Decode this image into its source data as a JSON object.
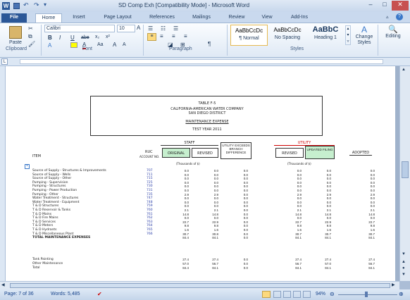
{
  "window": {
    "title": "SD Comp Exh [Compatibility Mode] - Microsoft Word",
    "qat_icons": [
      "word-icon",
      "save-icon",
      "undo-icon",
      "redo-icon",
      "customize-icon"
    ]
  },
  "tabs": [
    "File",
    "Home",
    "Insert",
    "Page Layout",
    "References",
    "Mailings",
    "Review",
    "View",
    "Add-Ins"
  ],
  "ribbon": {
    "clipboard": {
      "paste": "Paste",
      "group": "Clipboard"
    },
    "font": {
      "name": "Calibri",
      "size": "10",
      "group": "Font",
      "buttons": [
        "B",
        "I",
        "U",
        "abe",
        "x₂",
        "x²",
        "A",
        "Aa",
        "A",
        "A"
      ]
    },
    "paragraph": {
      "group": "Paragraph",
      "pilcrow": "¶"
    },
    "styles": {
      "group": "Styles",
      "items": [
        {
          "preview": "AaBbCcDc",
          "label": "¶ Normal"
        },
        {
          "preview": "AaBbCcDc",
          "label": "No Spacing"
        },
        {
          "preview": "AaBbC",
          "label": "Heading 1"
        }
      ],
      "change": "Change Styles",
      "editing": "Editing"
    }
  },
  "document": {
    "table_title": "TABLE F-5",
    "company": "CALIFORNIA-AMERICAN WATER COMPANY",
    "district": "SAN DIEGO DISTRICT",
    "section": "MAINTENANCE  EXPENSE",
    "year": "TEST YEAR 2011",
    "headers": {
      "staff": "STAFF",
      "original": "ORIGINAL",
      "revised": "REVISED",
      "utility": "UTILITY EXCEEDS BRANCH DIFFERENCE",
      "utility_label": "UTILITY",
      "revised2": "REVISED",
      "updated": "UPDATED FILING",
      "adopted": "ADOPTED",
      "item": "ITEM",
      "ruc": "RUC",
      "account": "ACCOUNT NO.",
      "thousands": "(Thousands of $)"
    },
    "rows": [
      {
        "item": "Source of Supply - Structures & Improvements",
        "acct": "707",
        "v": [
          "0.0",
          "0.0",
          "0.0",
          "0.0",
          "0.0",
          "0.0"
        ]
      },
      {
        "item": "Source of Supply - Wells",
        "acct": "711",
        "v": [
          "0.0",
          "0.0",
          "0.0",
          "0.0",
          "0.0",
          "0.0"
        ]
      },
      {
        "item": "Source of Supply - Other",
        "acct": "715",
        "v": [
          "0.0",
          "0.0",
          "0.0",
          "0.0",
          "0.0",
          "0.0"
        ]
      },
      {
        "item": "Pumping - Supervision",
        "acct": "725",
        "v": [
          "0.0",
          "0.0",
          "0.0",
          "0.0",
          "0.0",
          "0.0"
        ]
      },
      {
        "item": "Pumping - Structures",
        "acct": "730",
        "v": [
          "0.0",
          "0.0",
          "0.0",
          "0.0",
          "0.0",
          "0.0"
        ]
      },
      {
        "item": "Pumping - Power Production",
        "acct": "731",
        "v": [
          "0.0",
          "0.0",
          "0.0",
          "0.0",
          "0.0",
          "0.0"
        ]
      },
      {
        "item": "Pumping - Other",
        "acct": "735",
        "v": [
          "2.9",
          "2.9",
          "0.0",
          "2.9",
          "2.9",
          "2.9"
        ]
      },
      {
        "item": "Water Treatment - Structures",
        "acct": "747",
        "v": [
          "0.0",
          "0.0",
          "0.0",
          "0.0",
          "0.0",
          "0.0"
        ]
      },
      {
        "item": "Water Treatment - Equipment",
        "acct": "748",
        "v": [
          "0.0",
          "0.0",
          "0.0",
          "0.0",
          "0.0",
          "0.0"
        ]
      },
      {
        "item": "T & D Structures",
        "acct": "759",
        "v": [
          "0.0",
          "0.0",
          "0.0",
          "0.0",
          "0.0",
          "0.0"
        ]
      },
      {
        "item": "T & D Reservoir & Tanks",
        "acct": "760",
        "v": [
          "2.1",
          "2.1",
          "0.0",
          "2.1",
          "2.1",
          "2.1"
        ]
      },
      {
        "item": "T & D Mains",
        "acct": "761",
        "v": [
          "14.8",
          "14.8",
          "0.0",
          "14.8",
          "14.8",
          "14.8"
        ]
      },
      {
        "item": "T & D Fire Mains",
        "acct": "762",
        "v": [
          "0.0",
          "0.0",
          "0.0",
          "0.0",
          "0.0",
          "0.0"
        ]
      },
      {
        "item": "T & D Services",
        "acct": "763",
        "v": [
          "22.7",
          "22.9",
          "0.0",
          "22.7",
          "22.9",
          "22.7"
        ]
      },
      {
        "item": "T & D Meters",
        "acct": "764",
        "v": [
          "9.8",
          "9.8",
          "0.0",
          "9.8",
          "9.8",
          "9.8"
        ]
      },
      {
        "item": "T & D Hydrants",
        "acct": "765",
        "v": [
          "1.6",
          "1.6",
          "0.0",
          "1.6",
          "1.6",
          "1.6"
        ]
      },
      {
        "item": "T & D Miscellaneous Plant",
        "acct": "766",
        "v": [
          "30.7",
          "30.8",
          "0.0",
          "30.7",
          "30.7",
          "30.7"
        ]
      },
      {
        "item": "TOTAL MAINTENANCE EXPENSES",
        "acct": "",
        "v": [
          "84.4",
          "84.1",
          "0.0",
          "84.1",
          "84.1",
          "84.1"
        ]
      }
    ],
    "footer_rows": [
      {
        "item": "Tank Painting",
        "v": [
          "27.4",
          "27.4",
          "0.0",
          "27.4",
          "27.4",
          "27.4"
        ]
      },
      {
        "item": "Other Maintenance",
        "v": [
          "57.0",
          "56.7",
          "0.0",
          "56.7",
          "57.0",
          "56.7"
        ]
      },
      {
        "item": "Total",
        "v": [
          "84.4",
          "84.1",
          "0.0",
          "84.1",
          "84.1",
          "84.1"
        ]
      }
    ]
  },
  "status": {
    "page": "Page: 7 of 36",
    "words": "Words: 5,485",
    "zoom": "94%"
  }
}
